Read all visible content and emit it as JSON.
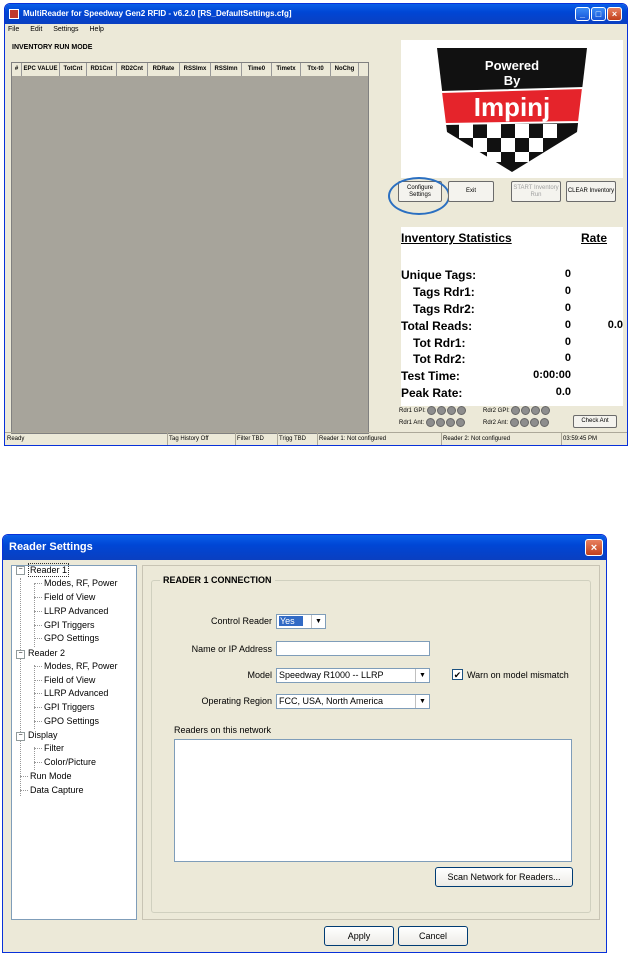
{
  "main_window": {
    "title": "MultiReader for Speedway Gen2 RFID - v6.2.0 [RS_DefaultSettings.cfg]",
    "menu": [
      "File",
      "Edit",
      "Settings",
      "Help"
    ],
    "mode_label": "INVENTORY RUN MODE",
    "grid_columns": [
      "#",
      "EPC VALUE",
      "TotCnt",
      "RD1Cnt",
      "RD2Cnt",
      "RDRate",
      "RSSImx",
      "RSSImn",
      "Time0",
      "Timetx",
      "Ttx-t0",
      "NoChg"
    ],
    "logo": {
      "top": "Powered",
      "by": "By",
      "brand": "Impinj"
    },
    "buttons": {
      "configure": "Configure Settings",
      "exit": "Exit",
      "start": "START Inventory Run",
      "clear": "CLEAR Inventory"
    },
    "stats": {
      "heading": "Inventory Statistics",
      "rate_heading": "Rate",
      "rows": [
        {
          "label": "Unique Tags:",
          "value": "0",
          "rate": ""
        },
        {
          "label": "Tags Rdr1:",
          "value": "0",
          "rate": ""
        },
        {
          "label": "Tags Rdr2:",
          "value": "0",
          "rate": ""
        },
        {
          "label": "Total Reads:",
          "value": "0",
          "rate": "0.0"
        },
        {
          "label": "Tot Rdr1:",
          "value": "0",
          "rate": ""
        },
        {
          "label": "Tot Rdr2:",
          "value": "0",
          "rate": ""
        },
        {
          "label": "Test Time:",
          "value": "0:00:00",
          "rate": ""
        },
        {
          "label": "Peak Rate:",
          "value": "0.0",
          "rate": ""
        }
      ]
    },
    "io": {
      "rdr1_gpi": "Rdr1 GPI:",
      "rdr1_ant": "Rdr1 Ant:",
      "rdr2_gpi": "Rdr2 GPI:",
      "rdr2_ant": "Rdr2 Ant:",
      "check_ant": "Check Ant"
    },
    "status": {
      "state": "Ready",
      "tag_history": "Tag History Off",
      "filter": "Filter TBD",
      "trigger": "Trigg TBD",
      "reader1": "Reader 1: Not configured",
      "reader2": "Reader 2: Not configured",
      "clock": "03:59:45 PM"
    }
  },
  "settings_window": {
    "title": "Reader Settings",
    "tree": {
      "reader1": "Reader 1",
      "reader1_children": [
        "Modes, RF, Power",
        "Field of View",
        "LLRP Advanced",
        "GPI Triggers",
        "GPO Settings"
      ],
      "reader2": "Reader 2",
      "reader2_children": [
        "Modes, RF, Power",
        "Field of View",
        "LLRP Advanced",
        "GPI Triggers",
        "GPO Settings"
      ],
      "display": "Display",
      "display_children": [
        "Filter",
        "Color/Picture"
      ],
      "run_mode": "Run Mode",
      "data_capture": "Data Capture"
    },
    "connection": {
      "legend": "READER 1 CONNECTION",
      "control_reader_label": "Control Reader",
      "control_reader_value": "Yes",
      "name_ip_label": "Name or IP Address",
      "name_ip_value": "",
      "model_label": "Model",
      "model_value": "Speedway R1000 -- LLRP",
      "warn_label": "Warn on model mismatch",
      "warn_checked": true,
      "region_label": "Operating Region",
      "region_value": "FCC, USA, North America",
      "network_label": "Readers on this network",
      "scan_button": "Scan Network for Readers..."
    },
    "apply_button": "Apply",
    "cancel_button": "Cancel"
  }
}
